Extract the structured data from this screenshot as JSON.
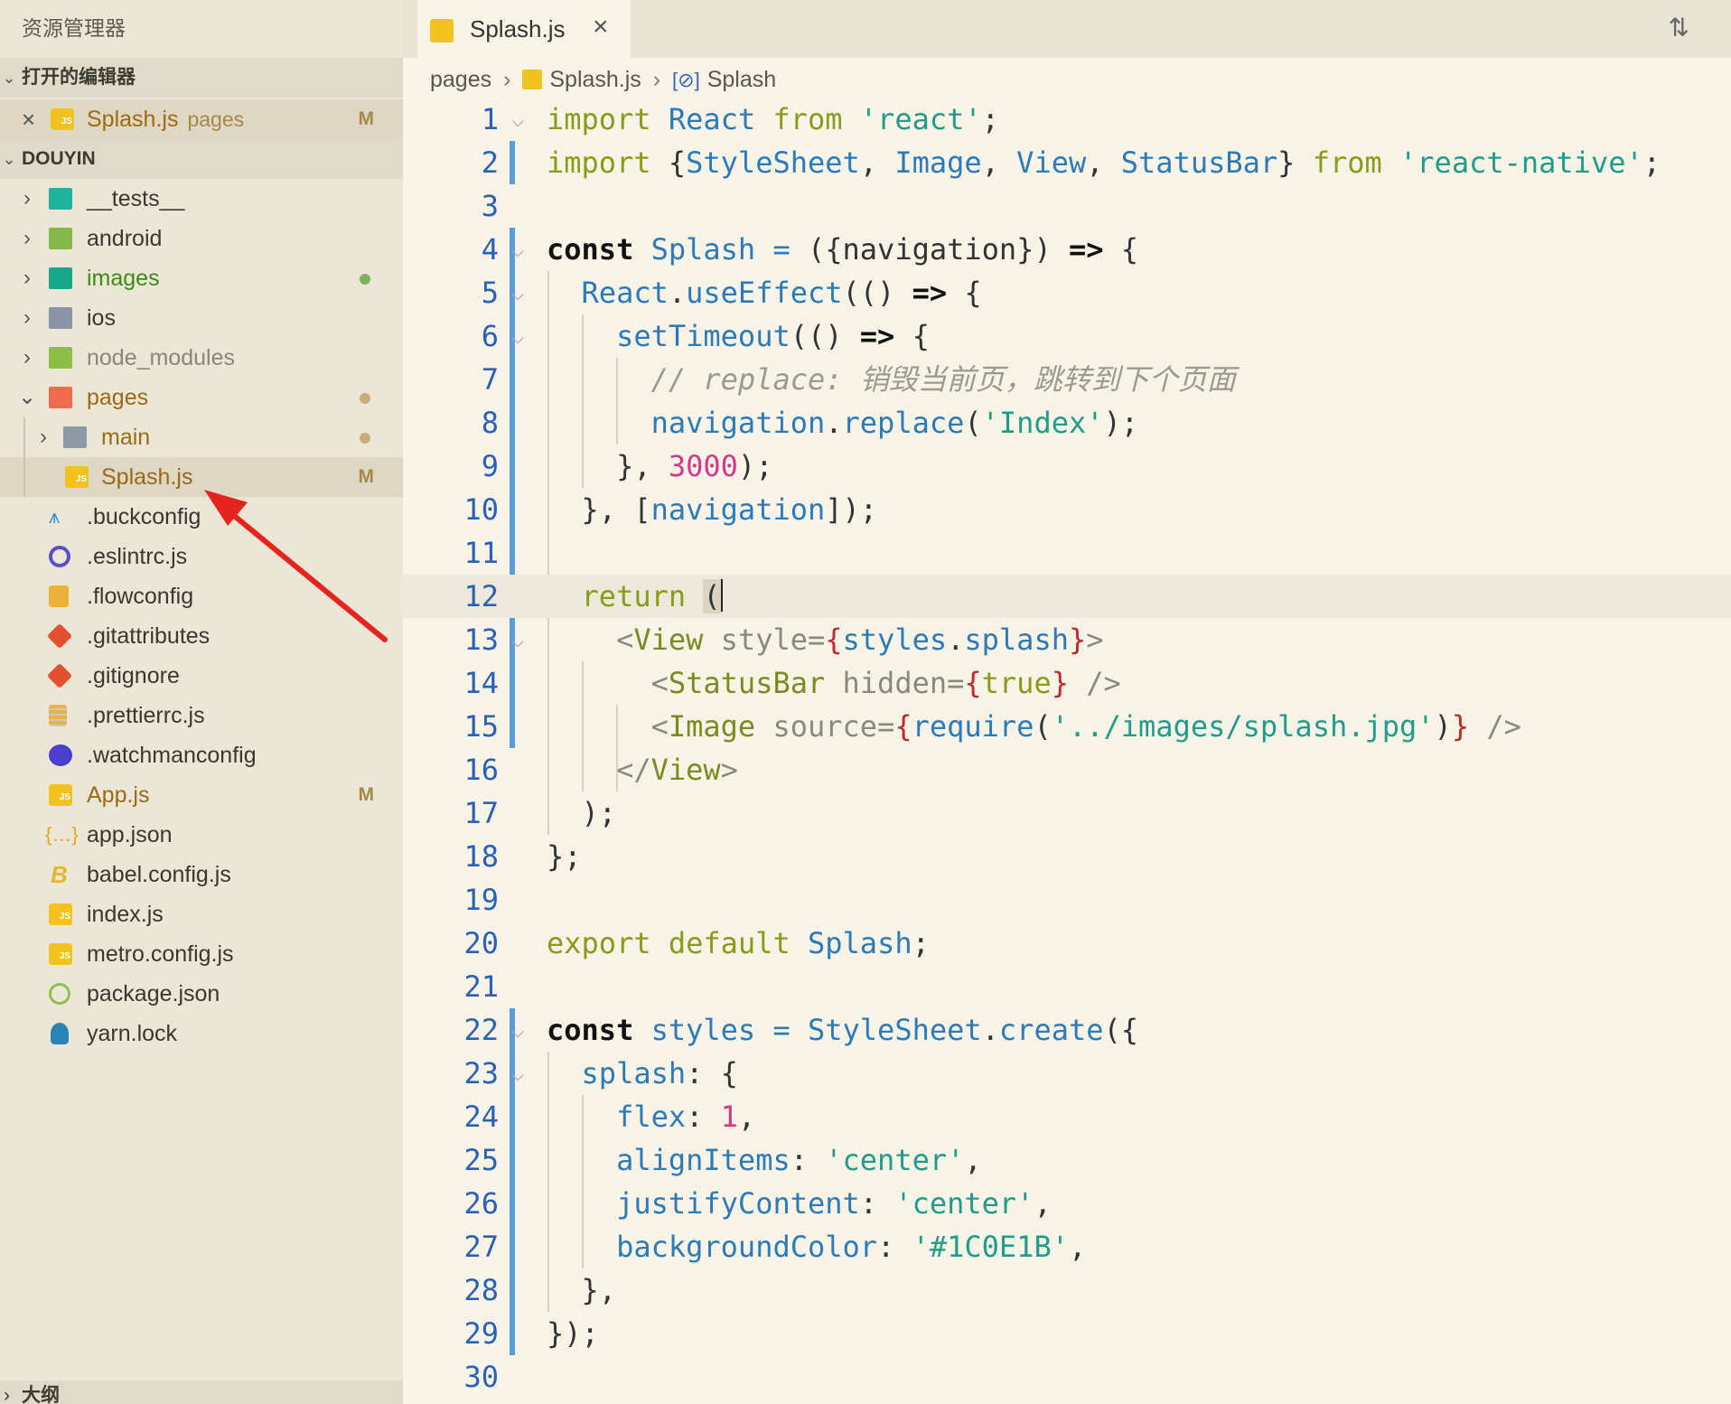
{
  "sidebar": {
    "title": "资源管理器",
    "open_editors": {
      "header": "打开的编辑器",
      "items": [
        {
          "name": "Splash.js",
          "folder": "pages",
          "mark": "M"
        }
      ]
    },
    "project": {
      "header": "DOUYIN",
      "items": [
        {
          "name": "__tests__"
        },
        {
          "name": "android"
        },
        {
          "name": "images"
        },
        {
          "name": "ios"
        },
        {
          "name": "node_modules"
        },
        {
          "name": "pages"
        },
        {
          "name": "main"
        },
        {
          "name": "Splash.js",
          "mark": "M"
        },
        {
          "name": ".buckconfig"
        },
        {
          "name": ".eslintrc.js"
        },
        {
          "name": ".flowconfig"
        },
        {
          "name": ".gitattributes"
        },
        {
          "name": ".gitignore"
        },
        {
          "name": ".prettierrc.js"
        },
        {
          "name": ".watchmanconfig"
        },
        {
          "name": "App.js",
          "mark": "M"
        },
        {
          "name": "app.json"
        },
        {
          "name": "babel.config.js"
        },
        {
          "name": "index.js"
        },
        {
          "name": "metro.config.js"
        },
        {
          "name": "package.json"
        },
        {
          "name": "yarn.lock"
        }
      ]
    },
    "outline_header": "大纲"
  },
  "editor": {
    "tab": {
      "label": "Splash.js",
      "close": "×"
    },
    "breadcrumbs": [
      "pages",
      "Splash.js",
      "Splash"
    ],
    "line_numbers": [
      "1",
      "2",
      "3",
      "4",
      "5",
      "6",
      "7",
      "8",
      "9",
      "10",
      "11",
      "12",
      "13",
      "14",
      "15",
      "16",
      "17",
      "18",
      "19",
      "20",
      "21",
      "22",
      "23",
      "24",
      "25",
      "26",
      "27",
      "28",
      "29",
      "30"
    ],
    "code": {
      "l1": [
        "import",
        "React",
        "from",
        "'react'",
        ";"
      ],
      "l2": [
        "import",
        "{",
        "StyleSheet",
        ",",
        "Image",
        ",",
        "View",
        ",",
        "StatusBar",
        "}",
        "from",
        "'react-native'",
        ";"
      ],
      "l4": [
        "const",
        "Splash",
        "=",
        "({navigation})",
        "=>",
        "{"
      ],
      "l5": [
        "React",
        ".",
        "useEffect",
        "(()",
        "=>",
        "{"
      ],
      "l6": [
        "setTimeout",
        "(()",
        "=>",
        "{"
      ],
      "l7": "// replace: 销毁当前页，跳转到下个页面",
      "l8": [
        "navigation",
        ".",
        "replace",
        "(",
        "'Index'",
        ");"
      ],
      "l9": [
        "},",
        "3000",
        ");"
      ],
      "l10": [
        "},",
        "[",
        "navigation",
        "]);"
      ],
      "l12": [
        "return",
        "("
      ],
      "l13": [
        "<",
        "View",
        "style",
        "=",
        "{",
        "styles",
        ".",
        "splash",
        "}",
        ">"
      ],
      "l14": [
        "<",
        "StatusBar",
        "hidden",
        "=",
        "{",
        "true",
        "}",
        "/>"
      ],
      "l15": [
        "<",
        "Image",
        "source",
        "=",
        "{",
        "require",
        "(",
        "'../images/splash.jpg'",
        ")",
        "}",
        "/>"
      ],
      "l16": [
        "</",
        "View",
        ">"
      ],
      "l17": [
        ");"
      ],
      "l18": [
        "};"
      ],
      "l20": [
        "export",
        "default",
        "Splash",
        ";"
      ],
      "l22": [
        "const",
        "styles",
        "=",
        "StyleSheet",
        ".",
        "create",
        "({"
      ],
      "l23": [
        "splash",
        ": {"
      ],
      "l24": [
        "flex",
        ":",
        "1",
        ","
      ],
      "l25": [
        "alignItems",
        ":",
        "'center'",
        ","
      ],
      "l26": [
        "justifyContent",
        ":",
        "'center'",
        ","
      ],
      "l27": [
        "backgroundColor",
        ":",
        "'#1C0E1B'",
        ","
      ],
      "l28": [
        "},"
      ],
      "l29": [
        "});"
      ]
    }
  }
}
